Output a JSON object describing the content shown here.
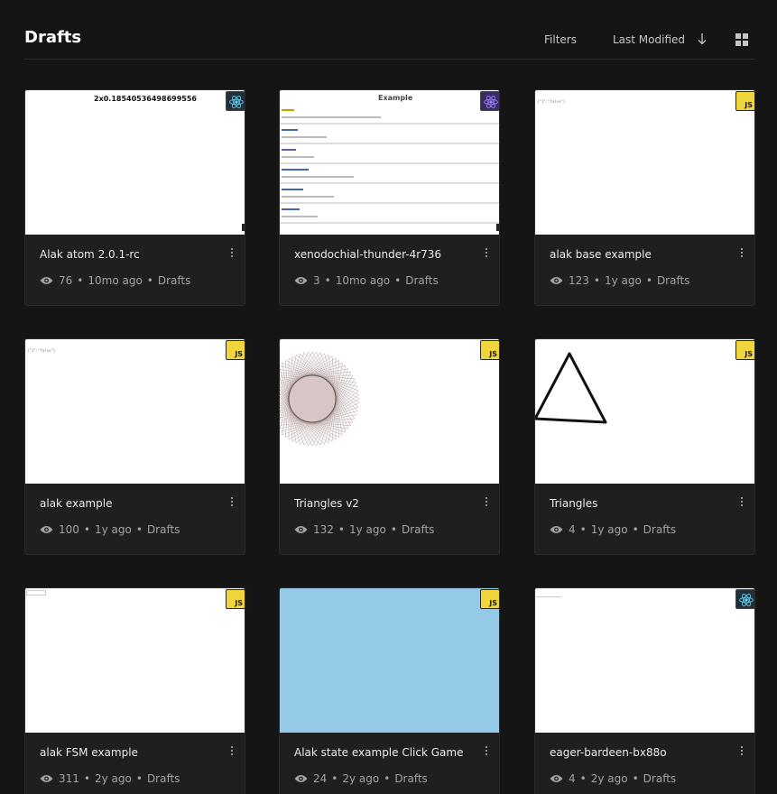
{
  "header": {
    "title": "Drafts",
    "filters_label": "Filters",
    "sort_label": "Last Modified"
  },
  "icons": {
    "sort": "arrow-down-icon",
    "view": "grid-view-icon",
    "views": "eye-icon",
    "menu": "kebab-menu-icon",
    "template_js": "javascript-badge",
    "template_react": "react-badge"
  },
  "colors": {
    "background": "#151515",
    "card": "#1f1f1f",
    "js_badge": "#f0d63c",
    "react": "#61dafb",
    "sky_thumb": "#95c9e8"
  },
  "thumbs": {
    "atom_title": "2x0.18540536498699556",
    "example_title": "Example",
    "console": "{\"1\":\"false\"}",
    "counter_text": "(none)"
  },
  "cards": [
    {
      "title": "Alak atom 2.0.1-rc",
      "views": "76",
      "time": "10mo ago",
      "folder": "Drafts",
      "template": "react"
    },
    {
      "title": "xenodochial-thunder-4r736",
      "views": "3",
      "time": "10mo ago",
      "folder": "Drafts",
      "template": "react"
    },
    {
      "title": "alak base example",
      "views": "123",
      "time": "1y ago",
      "folder": "Drafts",
      "template": "js"
    },
    {
      "title": "alak example",
      "views": "100",
      "time": "1y ago",
      "folder": "Drafts",
      "template": "js"
    },
    {
      "title": "Triangles v2",
      "views": "132",
      "time": "1y ago",
      "folder": "Drafts",
      "template": "js"
    },
    {
      "title": "Triangles",
      "views": "4",
      "time": "1y ago",
      "folder": "Drafts",
      "template": "js"
    },
    {
      "title": "alak FSM example",
      "views": "311",
      "time": "2y ago",
      "folder": "Drafts",
      "template": "js"
    },
    {
      "title": "Alak state example Click Game",
      "views": "24",
      "time": "2y ago",
      "folder": "Drafts",
      "template": "js"
    },
    {
      "title": "eager-bardeen-bx88o",
      "views": "4",
      "time": "2y ago",
      "folder": "Drafts",
      "template": "react"
    }
  ],
  "badges": {
    "js_label": "JS"
  },
  "separator": "•"
}
